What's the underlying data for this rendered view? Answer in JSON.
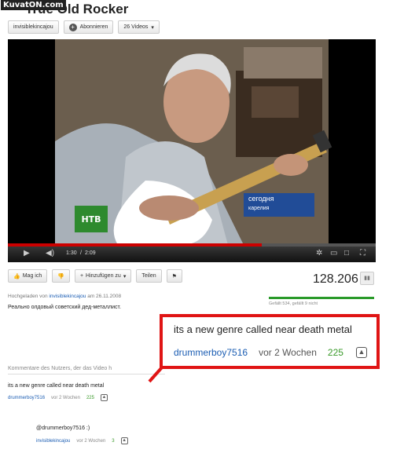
{
  "watermark": "KuvatON.com",
  "video_title": "True Old Rocker",
  "channel": {
    "name": "invisiblekincajou",
    "subscribe_label": "Abonnieren",
    "videos_label": "26 Videos"
  },
  "video": {
    "overlay_caption": "сегодня",
    "overlay_subcaption": "карелия",
    "channel_logo": "НТВ",
    "time_current": "1:30",
    "time_total": "2:09",
    "progress": 0.69
  },
  "actions": {
    "like_label": "Mag ich",
    "add_label": "Hinzufügen zu",
    "share_label": "Teilen"
  },
  "stats": {
    "views": "128.206",
    "likes_text": "Gefällt 534, gefällt 9 nicht",
    "like_ratio": 0.98
  },
  "upload": {
    "prefix": "Hochgeladen von",
    "user": "invisiblekincajou",
    "date_text": "am 26.11.2008"
  },
  "description": "Реально олдовый советский дед-металлист.",
  "comments_heading": "Kommentare des Nutzers, der das Video h",
  "comments": [
    {
      "text": "its a new genre called near death metal",
      "user": "drummerboy7516",
      "when": "vor 2 Wochen",
      "score": "225"
    },
    {
      "text": "@drummerboy7516 :)",
      "user": "invisiblekincajou",
      "when": "vor 2 Wochen",
      "score": "3"
    }
  ],
  "highlight": {
    "text": "its a new genre called near death metal",
    "user": "drummerboy7516",
    "when": "vor 2 Wochen",
    "score": "225"
  },
  "colors": {
    "highlight_border": "#e01414",
    "link": "#1b5db3",
    "score": "#3a9a2a",
    "progress": "#cc0000"
  }
}
